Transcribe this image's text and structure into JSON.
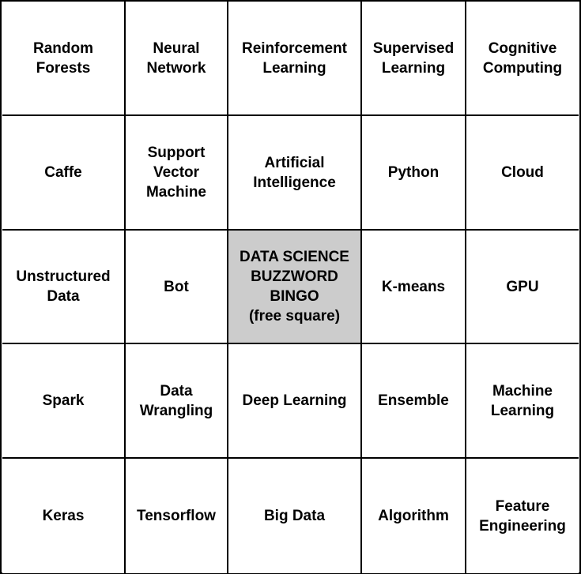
{
  "colors": {
    "free_square_bg": "#cccccc",
    "border": "#000000",
    "background": "#ffffff"
  },
  "cells": [
    {
      "text": "Random\nForests"
    },
    {
      "text": "Neural\nNetwork"
    },
    {
      "text": "Reinforcement\nLearning"
    },
    {
      "text": "Supervised\nLearning"
    },
    {
      "text": "Cognitive\nComputing"
    },
    {
      "text": "Caffe"
    },
    {
      "text": "Support\nVector\nMachine"
    },
    {
      "text": "Artificial\nIntelligence"
    },
    {
      "text": "Python"
    },
    {
      "text": "Cloud"
    },
    {
      "text": "Unstructured\nData"
    },
    {
      "text": "Bot"
    },
    {
      "text": "DATA SCIENCE\nBUZZWORD\nBINGO\n(free square)"
    },
    {
      "text": "K-means"
    },
    {
      "text": "GPU"
    },
    {
      "text": "Spark"
    },
    {
      "text": "Data\nWrangling"
    },
    {
      "text": "Deep Learning"
    },
    {
      "text": "Ensemble"
    },
    {
      "text": "Machine\nLearning"
    },
    {
      "text": "Keras"
    },
    {
      "text": "Tensorflow"
    },
    {
      "text": "Big Data"
    },
    {
      "text": "Algorithm"
    },
    {
      "text": "Feature\nEngineering"
    }
  ]
}
